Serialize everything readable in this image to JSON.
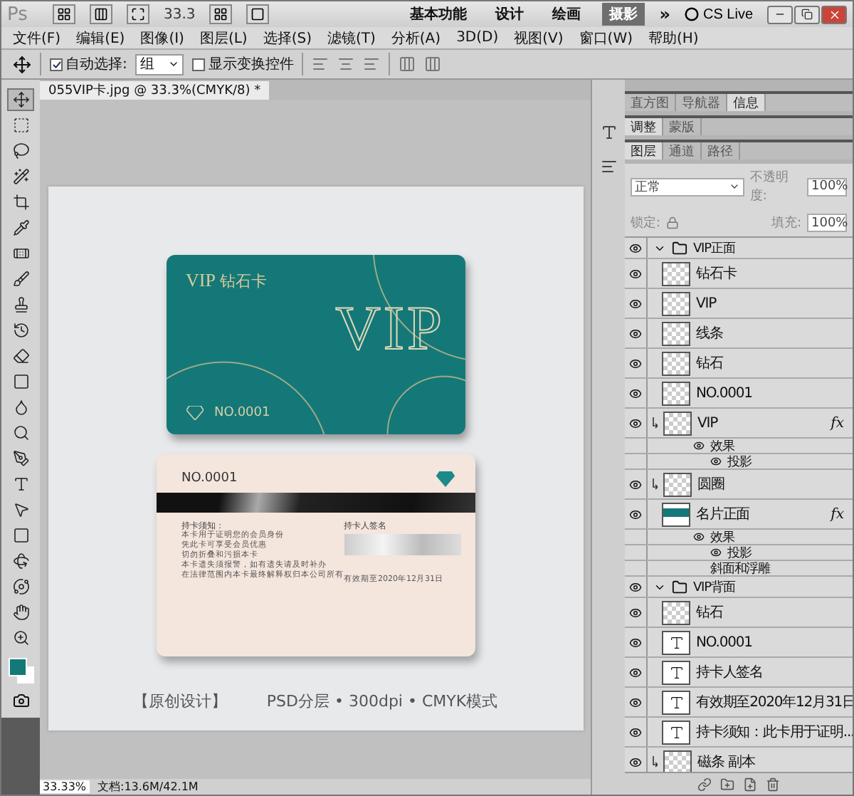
{
  "app_bar": {
    "logo": "Ps",
    "zoom": "33.3",
    "workspaces": [
      {
        "label": "基本功能",
        "selected": false
      },
      {
        "label": "设计",
        "selected": false
      },
      {
        "label": "绘画",
        "selected": false
      },
      {
        "label": "摄影",
        "selected": true
      }
    ],
    "more": "»",
    "cs_live": "CS Live"
  },
  "menu": [
    "文件(F)",
    "编辑(E)",
    "图像(I)",
    "图层(L)",
    "选择(S)",
    "滤镜(T)",
    "分析(A)",
    "3D(D)",
    "视图(V)",
    "窗口(W)",
    "帮助(H)"
  ],
  "options": {
    "auto_select": {
      "label": "自动选择:",
      "checked": true,
      "value": "组"
    },
    "transform": {
      "label": "显示变换控件",
      "checked": false
    }
  },
  "document": {
    "tab": "055VIP卡.jpg @ 33.3%(CMYK/8) *",
    "card_front": {
      "vip": "VIP",
      "subtitle": "钻石卡",
      "big": "VIP",
      "number": "NO.0001"
    },
    "card_back": {
      "number": "NO.0001",
      "notice_title": "持卡须知：",
      "notice_lines": [
        "本卡用于证明您的会员身份",
        "凭此卡可享受会员优惠",
        "切勿折叠和污损本卡",
        "本卡遗失须报警，如有遗失请及时补办",
        "在法律范围内本卡最终解释权归本公司所有"
      ],
      "signature_label": "持卡人签名",
      "expiry": "有效期至2020年12月31日"
    },
    "caption_left": "【原创设计】",
    "caption_right": "PSD分层 • 300dpi • CMYK模式"
  },
  "status": {
    "zoom": "33.33%",
    "doc": "文档:13.6M/42.1M"
  },
  "panel_groups": [
    [
      {
        "label": "直方图",
        "selected": false
      },
      {
        "label": "导航器",
        "selected": false
      },
      {
        "label": "信息",
        "selected": true
      }
    ],
    [
      {
        "label": "调整",
        "selected": true
      },
      {
        "label": "蒙版",
        "selected": false
      }
    ],
    [
      {
        "label": "图层",
        "selected": true
      },
      {
        "label": "通道",
        "selected": false
      },
      {
        "label": "路径",
        "selected": false
      }
    ]
  ],
  "layers_panel": {
    "blend": "正常",
    "opacity_label": "不透明度:",
    "opacity": "100%",
    "lock_label": "锁定:",
    "fill_label": "填充:",
    "fill": "100%"
  },
  "layers": [
    {
      "kind": "group",
      "name": "VIP正面",
      "expanded": true,
      "children": [
        {
          "kind": "layer",
          "thumb": {
            "kind": "transparent"
          },
          "name": "钻石卡"
        },
        {
          "kind": "layer",
          "thumb": {
            "kind": "transparent"
          },
          "name": "VIP"
        },
        {
          "kind": "layer",
          "thumb": {
            "kind": "transparent"
          },
          "name": "线条"
        },
        {
          "kind": "layer",
          "thumb": {
            "kind": "transparent"
          },
          "name": "钻石"
        },
        {
          "kind": "layer",
          "thumb": {
            "kind": "transparent"
          },
          "name": "NO.0001"
        },
        {
          "kind": "layer",
          "thumb": {
            "kind": "transparent"
          },
          "name": "VIP",
          "clipped": true,
          "fx": "fx",
          "effects_label": "效果",
          "effects": [
            "投影"
          ]
        },
        {
          "kind": "layer",
          "thumb": {
            "kind": "transparent"
          },
          "name": "圆圈",
          "clipped": true
        },
        {
          "kind": "layer",
          "thumb": {
            "kind": "image"
          },
          "name": "名片正面",
          "fx": "fx",
          "effects_label": "效果",
          "effects": [
            "投影",
            "斜面和浮雕"
          ]
        }
      ]
    },
    {
      "kind": "group",
      "name": "VIP背面",
      "expanded": true,
      "children": [
        {
          "kind": "layer",
          "thumb": {
            "kind": "transparent"
          },
          "name": "钻石"
        },
        {
          "kind": "layer",
          "thumb": {
            "kind": "text"
          },
          "name": "NO.0001"
        },
        {
          "kind": "layer",
          "thumb": {
            "kind": "text"
          },
          "name": "持卡人签名"
        },
        {
          "kind": "layer",
          "thumb": {
            "kind": "text"
          },
          "name": "有效期至2020年12月31日"
        },
        {
          "kind": "layer",
          "thumb": {
            "kind": "text"
          },
          "name": "持卡须知：此卡用于证明..."
        },
        {
          "kind": "layer",
          "thumb": {
            "kind": "transparent"
          },
          "name": "磁条 副本",
          "clipped": true
        }
      ]
    }
  ]
}
